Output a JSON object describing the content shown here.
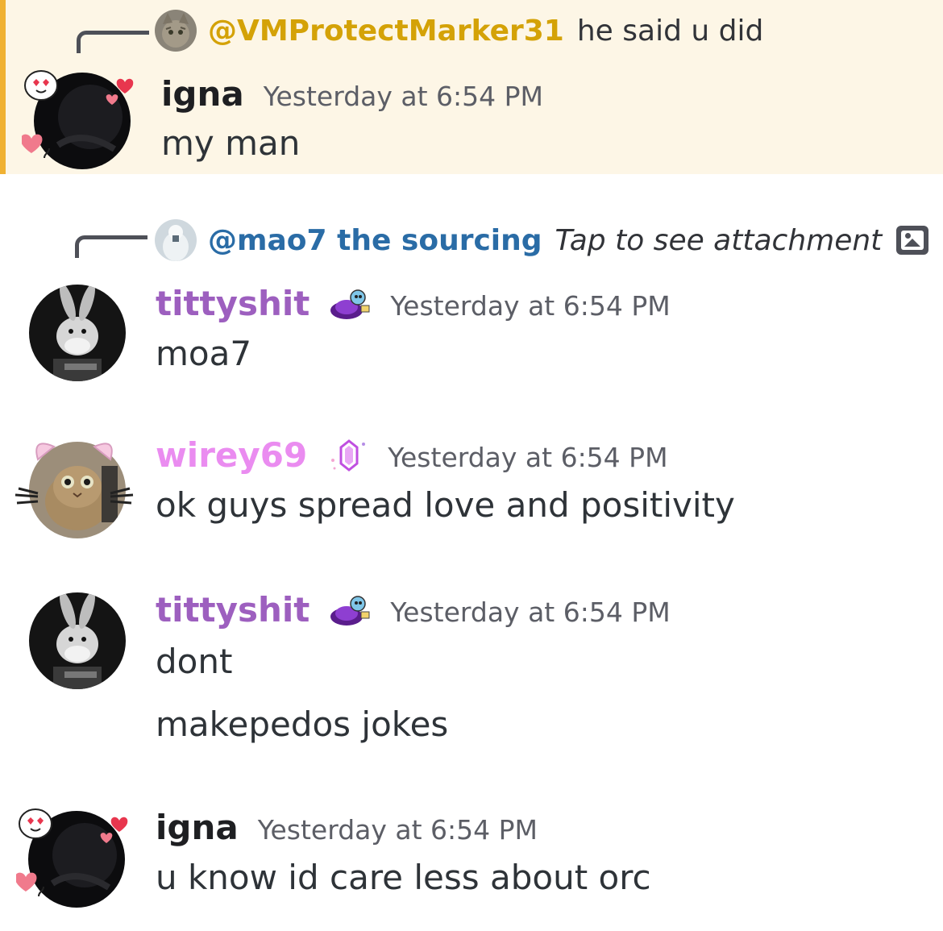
{
  "colors": {
    "highlight_bg": "#fdf6e6",
    "highlight_bar": "#f0b132",
    "mention_gold": "#d4a207",
    "mention_blue": "#2a6ca6",
    "tittyshit_purple": "#9d5fbf",
    "wirey_pink": "#ea8cf0",
    "igna_dark": "#1e1f22",
    "timestamp_gray": "#5c5e66"
  },
  "messages": [
    {
      "reply": {
        "mention": "@VMProtectMarker31",
        "text": "he said u did",
        "avatar_icon": "tabby-cat-icon"
      },
      "username": "igna",
      "timestamp": "Yesterday at 6:54 PM",
      "lines": [
        "my man"
      ],
      "avatar_icon": "dark-avatar-with-hearts-icon"
    },
    {
      "reply": {
        "mention": "@mao7 the sourcing",
        "text": "Tap to see attachment",
        "avatar_icon": "white-figure-icon",
        "attachment_icon": "image-icon"
      },
      "username": "tittyshit",
      "badge_icon": "purple-ufo-badge-icon",
      "timestamp": "Yesterday at 6:54 PM",
      "lines": [
        "moa7"
      ],
      "avatar_icon": "bugs-bunny-icon"
    },
    {
      "username": "wirey69",
      "badge_icon": "nitro-gem-badge-icon",
      "timestamp": "Yesterday at 6:54 PM",
      "lines": [
        "ok guys spread love and positivity"
      ],
      "avatar_icon": "cat-with-ears-icon"
    },
    {
      "username": "tittyshit",
      "badge_icon": "purple-ufo-badge-icon",
      "timestamp": "Yesterday at 6:54 PM",
      "lines": [
        "dont",
        "makepedos jokes"
      ],
      "avatar_icon": "bugs-bunny-icon"
    },
    {
      "username": "igna",
      "timestamp": "Yesterday at 6:54 PM",
      "lines": [
        "u know id care less about orc"
      ],
      "avatar_icon": "dark-avatar-with-hearts-icon"
    }
  ]
}
